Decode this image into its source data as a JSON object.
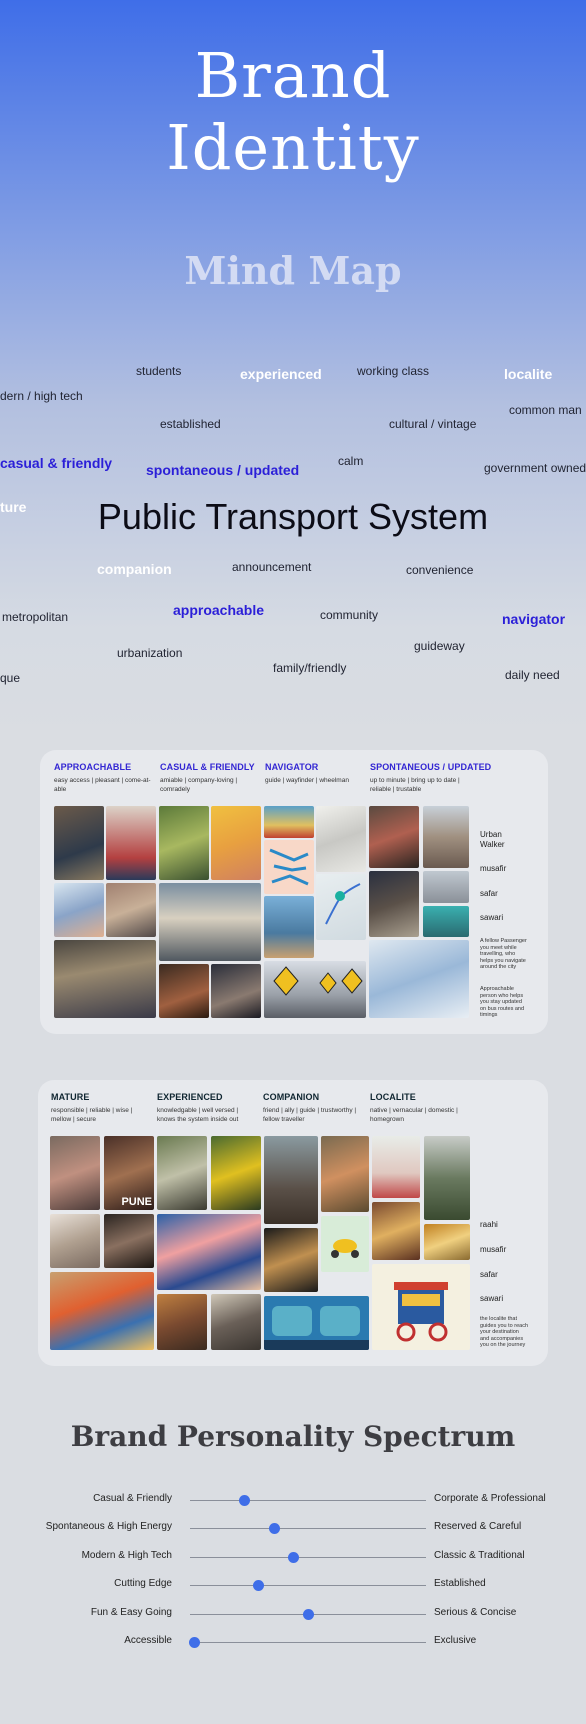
{
  "hero": {
    "title_line1": "Brand",
    "title_line2": "Identity",
    "subtitle": "Mind Map",
    "center": "Public Transport System",
    "words": [
      {
        "text": "students",
        "style": "normal"
      },
      {
        "text": "experienced",
        "style": "white"
      },
      {
        "text": "working class",
        "style": "normal"
      },
      {
        "text": "localite",
        "style": "white"
      },
      {
        "text": "dern / high tech",
        "style": "normal"
      },
      {
        "text": "established",
        "style": "normal"
      },
      {
        "text": "cultural / vintage",
        "style": "normal"
      },
      {
        "text": "common man",
        "style": "normal"
      },
      {
        "text": "casual & friendly",
        "style": "blue"
      },
      {
        "text": "spontaneous / updated",
        "style": "blue"
      },
      {
        "text": "calm",
        "style": "normal"
      },
      {
        "text": "government owned",
        "style": "normal"
      },
      {
        "text": "ture",
        "style": "white"
      },
      {
        "text": "companion",
        "style": "white"
      },
      {
        "text": "announcement",
        "style": "normal"
      },
      {
        "text": "convenience",
        "style": "normal"
      },
      {
        "text": "metropolitan",
        "style": "normal"
      },
      {
        "text": "approachable",
        "style": "blue"
      },
      {
        "text": "community",
        "style": "normal"
      },
      {
        "text": "navigator",
        "style": "blue"
      },
      {
        "text": "urbanization",
        "style": "normal"
      },
      {
        "text": "guideway",
        "style": "normal"
      },
      {
        "text": "family/friendly",
        "style": "normal"
      },
      {
        "text": "que",
        "style": "normal"
      },
      {
        "text": "daily need",
        "style": "normal"
      }
    ]
  },
  "board1": {
    "columns": [
      {
        "head": "APPROACHABLE",
        "sub": "easy access | pleasant | come-at-able"
      },
      {
        "head": "CASUAL & FRIENDLY",
        "sub": "amiable | company-loving | comradely"
      },
      {
        "head": "NAVIGATOR",
        "sub": "guide | wayfinder | wheelman"
      },
      {
        "head": "SPONTANEOUS / UPDATED",
        "sub": "up to minute | bring up to date | reliable | trustable"
      }
    ],
    "side_words": [
      "Urban Walker",
      "musafir",
      "safar",
      "sawari"
    ],
    "side_note_1": "A fellow Passenger you meet while travelling, who helps you navigate around the city",
    "side_note_2": "Approachable person who helps you stay updated on bus routes and timings"
  },
  "board2": {
    "columns": [
      {
        "head": "MATURE",
        "sub": "responsible | reliable | wise | mellow | secure"
      },
      {
        "head": "EXPERIENCED",
        "sub": "knowledgable | well versed | knows the system inside out"
      },
      {
        "head": "COMPANION",
        "sub": "friend | ally | guide | trustworthy | fellow traveller"
      },
      {
        "head": "LOCALITE",
        "sub": "native | vernacular | domestic | homegrown"
      }
    ],
    "side_words": [
      "raahi",
      "musafir",
      "safar",
      "sawari"
    ],
    "side_note": "the localite that guides you to reach your destination and accompanies you on the journey",
    "photo_caption": "PUNE"
  },
  "spectrum": {
    "title": "Brand Personality Spectrum",
    "accent": "#3f6ee8",
    "rows": [
      {
        "left": "Casual & Friendly",
        "right": "Corporate & Professional",
        "level": 0.23
      },
      {
        "left": "Spontaneous & High Energy",
        "right": "Reserved & Careful",
        "level": 0.36
      },
      {
        "left": "Modern & High Tech",
        "right": "Classic & Traditional",
        "level": 0.44
      },
      {
        "left": "Cutting Edge",
        "right": "Established",
        "level": 0.29
      },
      {
        "left": "Fun & Easy Going",
        "right": "Serious & Concise",
        "level": 0.5
      },
      {
        "left": "Accessible",
        "right": "Exclusive",
        "level": 0.02
      }
    ]
  }
}
